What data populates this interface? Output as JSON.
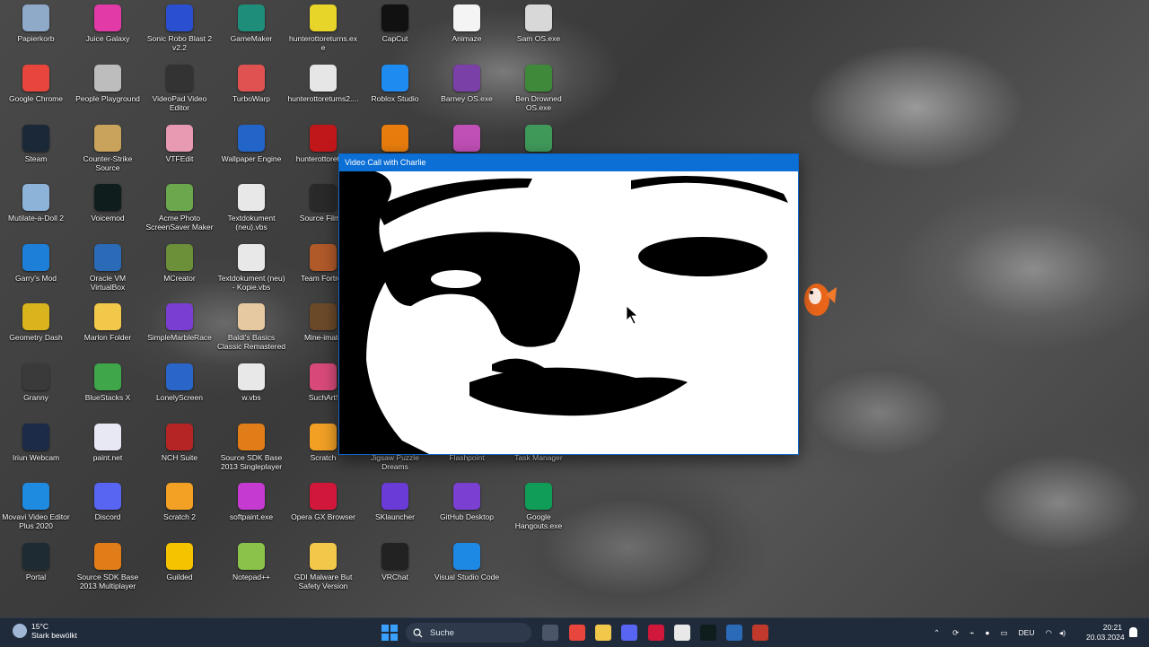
{
  "window": {
    "title": "Video Call with Charlie"
  },
  "desktop_icons": [
    {
      "label": "Papierkorb",
      "icon": "recycle-bin-icon",
      "color": "#8fa9c8"
    },
    {
      "label": "Juice Galaxy",
      "icon": "juice-galaxy-icon",
      "color": "#e23aa6"
    },
    {
      "label": "Sonic Robo Blast 2 v2.2",
      "icon": "sonic-icon",
      "color": "#2a4fd0"
    },
    {
      "label": "GameMaker",
      "icon": "gamemaker-icon",
      "color": "#1e8d7a"
    },
    {
      "label": "hunterottoreturns.exe",
      "icon": "yellow-hat-icon",
      "color": "#e8d52a"
    },
    {
      "label": "CapCut",
      "icon": "capcut-icon",
      "color": "#111111"
    },
    {
      "label": "Animaze",
      "icon": "document-icon",
      "color": "#f4f4f4"
    },
    {
      "label": "Sam OS.exe",
      "icon": "sam-os-icon",
      "color": "#d8d8d8"
    },
    {
      "label": "Google Chrome",
      "icon": "chrome-icon",
      "color": "#e8453c"
    },
    {
      "label": "People Playground",
      "icon": "people-playground-icon",
      "color": "#bdbdbd"
    },
    {
      "label": "VideoPad Video Editor",
      "icon": "videopad-icon",
      "color": "#333333"
    },
    {
      "label": "TurboWarp",
      "icon": "turbowarp-icon",
      "color": "#e05252"
    },
    {
      "label": "hunterottoreturns2....",
      "icon": "white-glove-icon",
      "color": "#e6e6e6"
    },
    {
      "label": "Roblox Studio",
      "icon": "roblox-studio-icon",
      "color": "#1d8bf0"
    },
    {
      "label": "Barney OS.exe",
      "icon": "barney-icon",
      "color": "#7b3fa8"
    },
    {
      "label": "Ben Drowned OS.exe",
      "icon": "ben-drowned-icon",
      "color": "#3f8a3a"
    },
    {
      "label": "Steam",
      "icon": "steam-icon",
      "color": "#1b2838"
    },
    {
      "label": "Counter-Strike Source",
      "icon": "counter-strike-icon",
      "color": "#c9a35c"
    },
    {
      "label": "VTFEdit",
      "icon": "vtfedit-icon",
      "color": "#e79ab2"
    },
    {
      "label": "Wallpaper Engine",
      "icon": "wallpaper-engine-icon",
      "color": "#2364c9"
    },
    {
      "label": "hunterottoreturn",
      "icon": "red-hat-icon",
      "color": "#c0171b"
    },
    {
      "label": "",
      "icon": "blender-icon",
      "color": "#e87d0d"
    },
    {
      "label": "",
      "icon": "party-icon",
      "color": "#c04fb6"
    },
    {
      "label": "",
      "icon": "cdg-icon",
      "color": "#3f9a5a"
    },
    {
      "label": "Mutilate-a-Doll 2",
      "icon": "doll-icon",
      "color": "#8db3d9"
    },
    {
      "label": "Voicemod",
      "icon": "voicemod-icon",
      "color": "#0f1d1d"
    },
    {
      "label": "Acme Photo ScreenSaver Maker",
      "icon": "acme-photo-icon",
      "color": "#6ba84d"
    },
    {
      "label": "Textdokument (neu).vbs",
      "icon": "vbs-script-icon",
      "color": "#e8e8e8"
    },
    {
      "label": "Source Filmm",
      "icon": "source-filmmaker-icon",
      "color": "#2a2a2a"
    },
    {
      "label": "Garry's Mod",
      "icon": "garrys-mod-icon",
      "color": "#1e7fd8"
    },
    {
      "label": "Oracle VM VirtualBox",
      "icon": "virtualbox-icon",
      "color": "#2a6ab7"
    },
    {
      "label": "MCreator",
      "icon": "mcreator-icon",
      "color": "#6c8f3a"
    },
    {
      "label": "Textdokument (neu) - Kopie.vbs",
      "icon": "vbs-script-icon",
      "color": "#e8e8e8"
    },
    {
      "label": "Team Fortres",
      "icon": "tf2-icon",
      "color": "#b15a2a"
    },
    {
      "label": "Geometry Dash",
      "icon": "geometry-dash-icon",
      "color": "#d9b41c"
    },
    {
      "label": "Marlon Folder",
      "icon": "folder-icon",
      "color": "#f2c84b"
    },
    {
      "label": "SimpleMarbleRace",
      "icon": "marble-icon",
      "color": "#7a3fd2"
    },
    {
      "label": "Baldi's Basics Classic Remastered",
      "icon": "baldi-icon",
      "color": "#e6c9a0"
    },
    {
      "label": "Mine-imato",
      "icon": "mine-imator-icon",
      "color": "#6b4a2a"
    },
    {
      "label": "Granny",
      "icon": "granny-icon",
      "color": "#3a3a3a"
    },
    {
      "label": "BlueStacks X",
      "icon": "bluestacks-icon",
      "color": "#3fa64a"
    },
    {
      "label": "LonelyScreen",
      "icon": "lonelyscreen-icon",
      "color": "#2a66c9"
    },
    {
      "label": "w.vbs",
      "icon": "vbs-script-icon",
      "color": "#e8e8e8"
    },
    {
      "label": "SuchArt!",
      "icon": "suchart-icon",
      "color": "#d94a7a"
    },
    {
      "label": "Iriun Webcam",
      "icon": "iriun-icon",
      "color": "#1c2b48"
    },
    {
      "label": "paint.net",
      "icon": "paintnet-icon",
      "color": "#e8e8f5"
    },
    {
      "label": "NCH Suite",
      "icon": "nch-icon",
      "color": "#b52525"
    },
    {
      "label": "Source SDK Base 2013 Singleplayer",
      "icon": "half-life-icon",
      "color": "#e07d18"
    },
    {
      "label": "Scratch",
      "icon": "scratch-icon",
      "color": "#f2a125"
    },
    {
      "label": "Jigsaw Puzzle Dreams",
      "icon": "jigsaw-icon",
      "color": "#888888"
    },
    {
      "label": "Flashpoint",
      "icon": "flashpoint-icon",
      "color": "#888888"
    },
    {
      "label": "Task Manager",
      "icon": "task-manager-icon",
      "color": "#888888"
    },
    {
      "label": "Movavi Video Editor Plus 2020",
      "icon": "movavi-icon",
      "color": "#1f8be0"
    },
    {
      "label": "Discord",
      "icon": "discord-icon",
      "color": "#5865f2"
    },
    {
      "label": "Scratch 2",
      "icon": "scratch-cat-icon",
      "color": "#f2a125"
    },
    {
      "label": "softpaint.exe",
      "icon": "softpaint-icon",
      "color": "#c53ad1"
    },
    {
      "label": "Opera GX Browser",
      "icon": "opera-gx-icon",
      "color": "#d1183a"
    },
    {
      "label": "SKlauncher",
      "icon": "sklauncher-icon",
      "color": "#6a3bd6"
    },
    {
      "label": "GitHub Desktop",
      "icon": "github-desktop-icon",
      "color": "#7b3fd2"
    },
    {
      "label": "Google Hangouts.exe",
      "icon": "hangouts-icon",
      "color": "#0f9d58"
    },
    {
      "label": "Portal",
      "icon": "portal-icon",
      "color": "#1e2b33"
    },
    {
      "label": "Source SDK Base 2013 Multiplayer",
      "icon": "half-life-icon",
      "color": "#e07d18"
    },
    {
      "label": "Guilded",
      "icon": "guilded-icon",
      "color": "#f5c400"
    },
    {
      "label": "Notepad++",
      "icon": "notepadpp-icon",
      "color": "#8bc34a"
    },
    {
      "label": "GDI Malware But Safety Version",
      "icon": "folder-icon",
      "color": "#f2c84b"
    },
    {
      "label": "VRChat",
      "icon": "vrchat-icon",
      "color": "#222222"
    },
    {
      "label": "Visual Studio Code",
      "icon": "vscode-icon",
      "color": "#1e88e5"
    }
  ],
  "taskbar": {
    "weather_temp": "15°C",
    "weather_desc": "Stark bewölkt",
    "search_placeholder": "Suche",
    "language": "DEU",
    "time": "20:21",
    "date": "20.03.2024",
    "apps": [
      {
        "icon": "file-explorer-sidebar-icon",
        "color": "#4a5568"
      },
      {
        "label": "",
        "icon": "chrome-icon",
        "color": "#e8453c"
      },
      {
        "icon": "file-explorer-icon",
        "color": "#f2c84b"
      },
      {
        "icon": "discord-icon",
        "color": "#5865f2"
      },
      {
        "icon": "opera-gx-icon",
        "color": "#d1183a"
      },
      {
        "icon": "store-icon",
        "color": "#e8e8e8"
      },
      {
        "icon": "voicemod-icon",
        "color": "#0f1d1d"
      },
      {
        "icon": "virtualbox-icon",
        "color": "#2a6ab7"
      },
      {
        "icon": "counter-icon",
        "color": "#c0392b"
      }
    ]
  }
}
